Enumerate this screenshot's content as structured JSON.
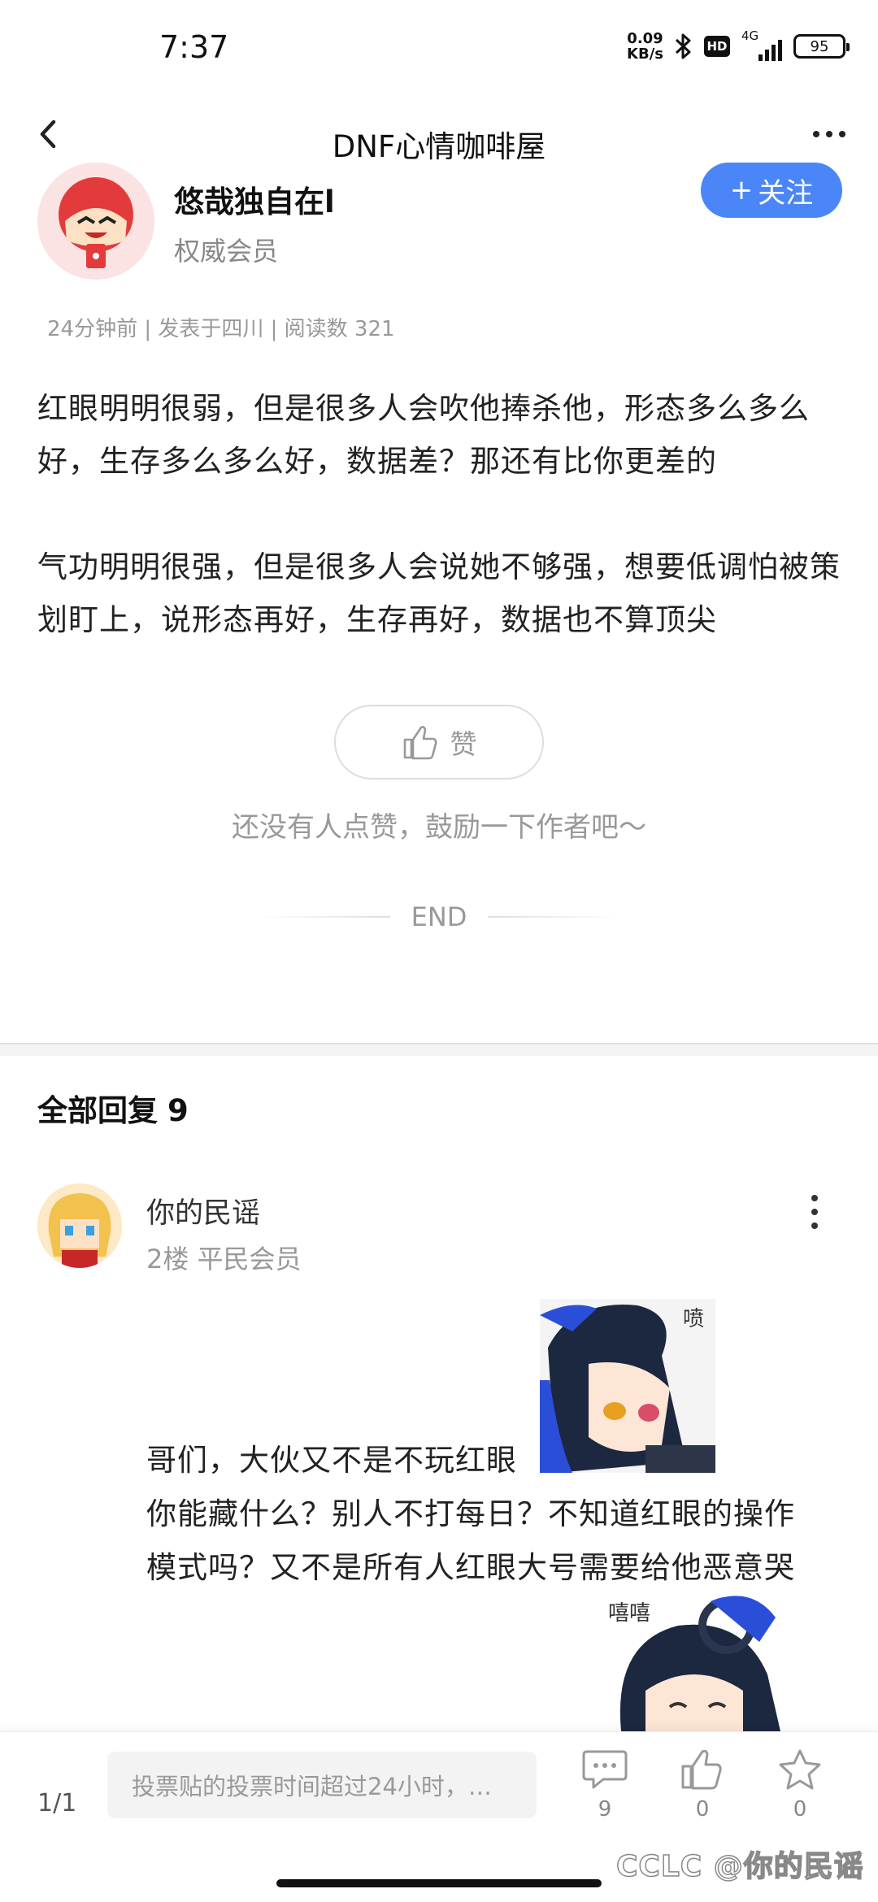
{
  "status_bar": {
    "time": "7:37",
    "net_speed_value": "0.09",
    "net_speed_unit": "KB/s",
    "hd_label": "HD",
    "signal_label": "4G",
    "battery": "95"
  },
  "header": {
    "title": "DNF心情咖啡屋"
  },
  "author": {
    "name": "悠哉独自在l",
    "level": "权威会员",
    "follow_label": "关注",
    "follow_plus": "+"
  },
  "post": {
    "meta": "24分钟前 | 发表于四川 | 阅读数 321",
    "paragraphs": [
      "红眼明明很弱，但是很多人会吹他捧杀他，形态多么多么好，生存多么多么好，数据差？那还有比你更差的",
      "气功明明很强，但是很多人会说她不够强，想要低调怕被策划盯上，说形态再好，生存再好，数据也不算顶尖"
    ],
    "like_label": "赞",
    "like_hint": "还没有人点赞，鼓励一下作者吧～",
    "end_label": "END"
  },
  "replies": {
    "title": "全部回复",
    "count": "9",
    "items": [
      {
        "name": "你的民谣",
        "meta": "2楼 平民会员",
        "sticker1_text": "喷",
        "sticker2_text": "嘻嘻",
        "lines": [
          "哥们，大伙又不是不玩红眼",
          "你能藏什么？别人不打每日？不知道红眼的操作",
          "模式吗？又不是所有人红眼大号需要给他恶意哭"
        ]
      }
    ]
  },
  "bottom_bar": {
    "page_indicator": "1/1",
    "input_placeholder": "投票贴的投票时间超过24小时，…",
    "comment_count": "9",
    "like_count": "0",
    "favorite_count": "0",
    "watermark": "CCLC @你的民谣"
  },
  "colors": {
    "accent": "#4a86f7",
    "text_primary": "#222222",
    "text_secondary": "#999999"
  }
}
